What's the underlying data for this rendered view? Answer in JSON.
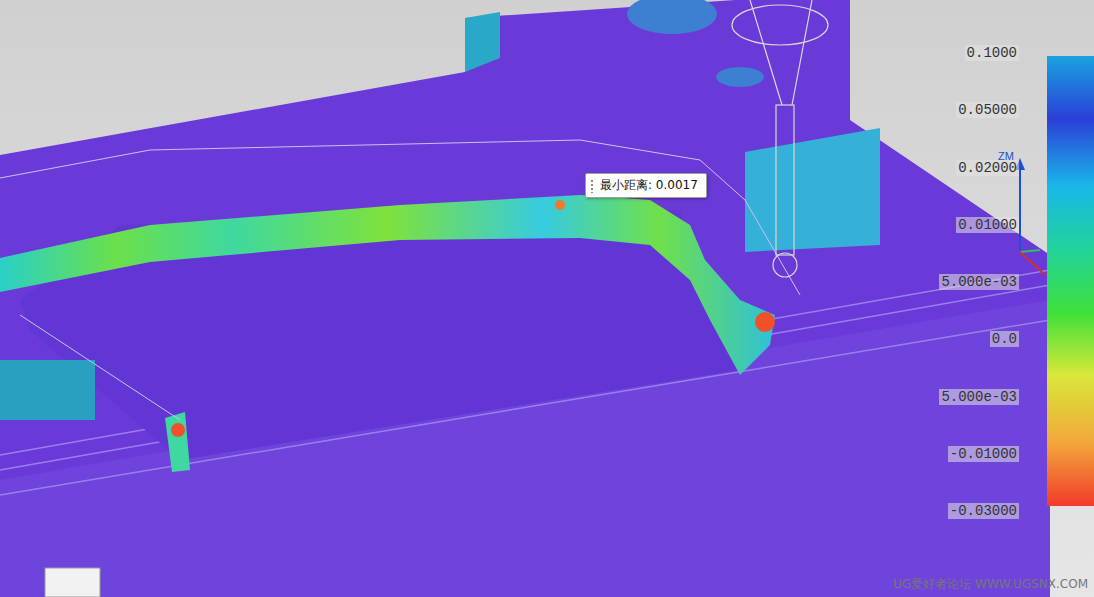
{
  "viewport": {
    "axis_label": "ZM"
  },
  "tooltip": {
    "text": "最小距离: 0.0017"
  },
  "legend": {
    "labels": [
      "0.1000",
      "0.05000",
      "0.02000",
      "0.01000",
      "5.000e-03",
      "0.0",
      "5.000e-03",
      "-0.01000",
      "-0.03000"
    ],
    "stops": [
      {
        "color": "#1aa3e0"
      },
      {
        "color": "#2a3fd8"
      },
      {
        "color": "#19b8e8"
      },
      {
        "color": "#22d39a"
      },
      {
        "color": "#3ee03a"
      },
      {
        "color": "#d9e83a"
      },
      {
        "color": "#f2a73a"
      },
      {
        "color": "#f23a2a"
      }
    ]
  },
  "watermark": "UG爱好者论坛 WWW.UGSNX.COM"
}
